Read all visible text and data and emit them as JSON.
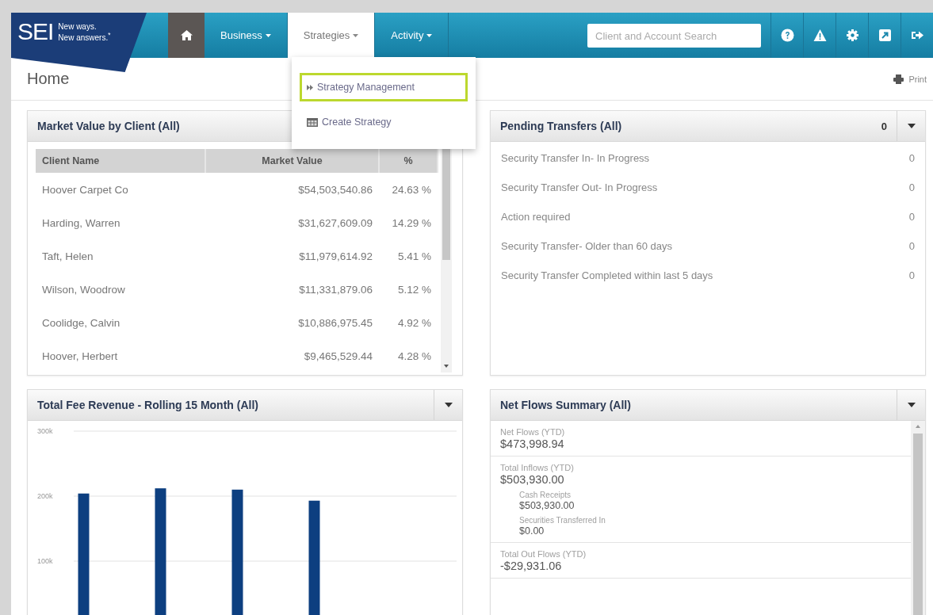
{
  "logo": {
    "wordmark": "SEI",
    "tagline": [
      "New ways.",
      "New answers.$^{*}$"
    ]
  },
  "nav": {
    "items": [
      {
        "label": "Business",
        "selected": false
      },
      {
        "label": "Strategies",
        "selected": true
      },
      {
        "label": "Activity",
        "selected": false
      }
    ]
  },
  "search": {
    "placeholder": "Client and Account Search"
  },
  "page": {
    "title": "Home",
    "print": "Print"
  },
  "dropdown": {
    "items": [
      {
        "label": "Strategy Management",
        "kind": "link",
        "selected": true
      },
      {
        "label": "Create Strategy",
        "kind": "create",
        "selected": false
      }
    ]
  },
  "market_value": {
    "title": "Market Value by Client (All)",
    "columns": [
      "Client Name",
      "Market Value",
      "%"
    ],
    "rows": [
      [
        "Hoover Carpet Co",
        "$54,503,540.86",
        "24.63 %"
      ],
      [
        "Harding, Warren",
        "$31,627,609.09",
        "14.29 %"
      ],
      [
        "Taft, Helen",
        "$11,979,614.92",
        "5.41 %"
      ],
      [
        "Wilson, Woodrow",
        "$11,331,879.06",
        "5.12 %"
      ],
      [
        "Coolidge, Calvin",
        "$10,886,975.45",
        "4.92 %"
      ],
      [
        "Hoover, Herbert",
        "$9,465,529.44",
        "4.28 %"
      ]
    ]
  },
  "pending_transfers": {
    "title": "Pending Transfers (All)",
    "count": "0",
    "rows": [
      {
        "label": "Security Transfer In- In Progress",
        "value": "0"
      },
      {
        "label": "Security Transfer Out- In Progress",
        "value": "0"
      },
      {
        "label": "Action required",
        "value": "0"
      },
      {
        "label": "Security Transfer- Older than 60 days",
        "value": "0"
      },
      {
        "label": "Security Transfer Completed within last 5 days",
        "value": "0"
      }
    ]
  },
  "fee_revenue": {
    "title": "Total Fee Revenue - Rolling 15 Month (All)",
    "chart_data": {
      "type": "bar",
      "values": [
        204000,
        212000,
        210000,
        193000,
        null
      ],
      "ylim": [
        0,
        300000
      ],
      "yticks": [
        {
          "value": 100000,
          "label": "100k"
        },
        {
          "value": 200000,
          "label": "200k"
        },
        {
          "value": 300000,
          "label": "300k"
        }
      ]
    }
  },
  "net_flows": {
    "title": "Net Flows Summary (All)",
    "items": [
      {
        "label": "Net Flows (YTD)",
        "value": "$473,998.94"
      },
      {
        "label": "Total Inflows (YTD)",
        "value": "$503,930.00",
        "children": [
          {
            "label": "Cash Receipts",
            "value": "$503,930.00"
          },
          {
            "label": "Securities Transferred In",
            "value": "$0.00"
          }
        ]
      },
      {
        "label": "Total Out Flows (YTD)",
        "value": "-$29,931.06"
      }
    ]
  }
}
